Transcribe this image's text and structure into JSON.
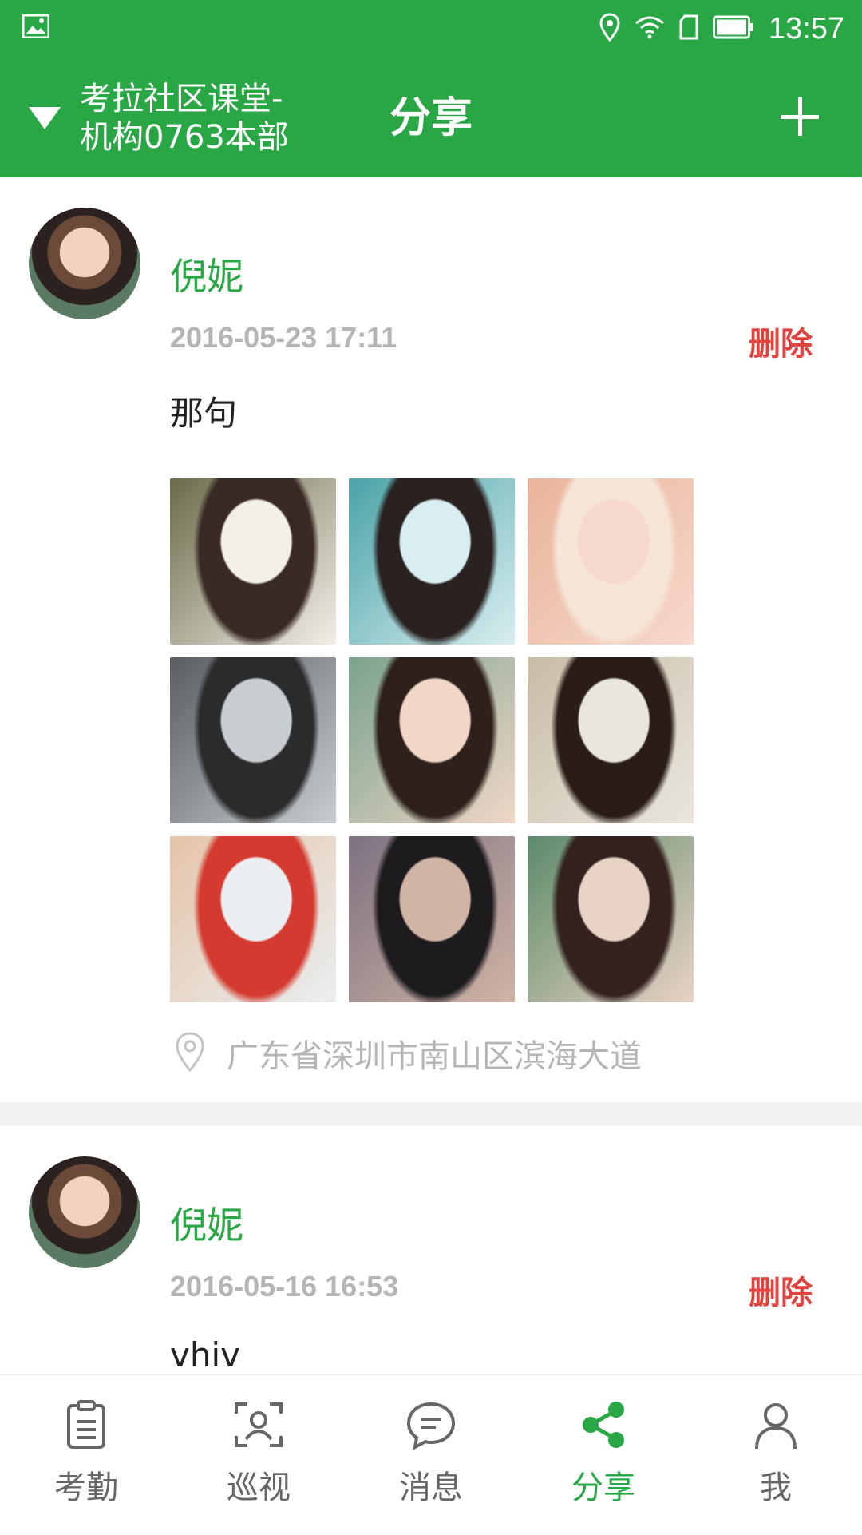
{
  "status_bar": {
    "time": "13:57"
  },
  "header": {
    "org_line1": "考拉社区课堂-",
    "org_line2": "机构0763本部",
    "title": "分享"
  },
  "posts": [
    {
      "author": "倪妮",
      "time": "2016-05-23 17:11",
      "delete_label": "删除",
      "text": "那句",
      "location": "广东省深圳市南山区滨海大道",
      "images": [
        {
          "colors": [
            "#f2efe8",
            "#3a2a25",
            "#6a6b4a"
          ]
        },
        {
          "colors": [
            "#d9eef0",
            "#2a2220",
            "#4aa3a8"
          ]
        },
        {
          "colors": [
            "#f7d8cc",
            "#f6e4d6",
            "#e9b49a"
          ]
        },
        {
          "colors": [
            "#c8cdd1",
            "#2b2b2c",
            "#5a5d60"
          ]
        },
        {
          "colors": [
            "#f0d7c7",
            "#2e211c",
            "#7aa28e"
          ]
        },
        {
          "colors": [
            "#e9e6de",
            "#2a1d18",
            "#c9bca6"
          ]
        },
        {
          "colors": [
            "#eaeef0",
            "#d43a2f",
            "#e5c4a8"
          ]
        },
        {
          "colors": [
            "#d0b4a6",
            "#1e1b1e",
            "#7d7180"
          ]
        },
        {
          "colors": [
            "#e9d2c6",
            "#34221f",
            "#5c8a6a"
          ]
        }
      ]
    },
    {
      "author": "倪妮",
      "time": "2016-05-16 16:53",
      "delete_label": "删除",
      "text": "vhiv"
    }
  ],
  "tabs": [
    {
      "label": "考勤",
      "icon": "clipboard-icon"
    },
    {
      "label": "巡视",
      "icon": "scan-person-icon"
    },
    {
      "label": "消息",
      "icon": "chat-bubble-icon"
    },
    {
      "label": "分享",
      "icon": "share-icon",
      "active": true
    },
    {
      "label": "我",
      "icon": "person-icon"
    }
  ],
  "colors": {
    "brand": "#2aa745",
    "delete": "#e0423e",
    "muted": "#b5b5b5"
  }
}
